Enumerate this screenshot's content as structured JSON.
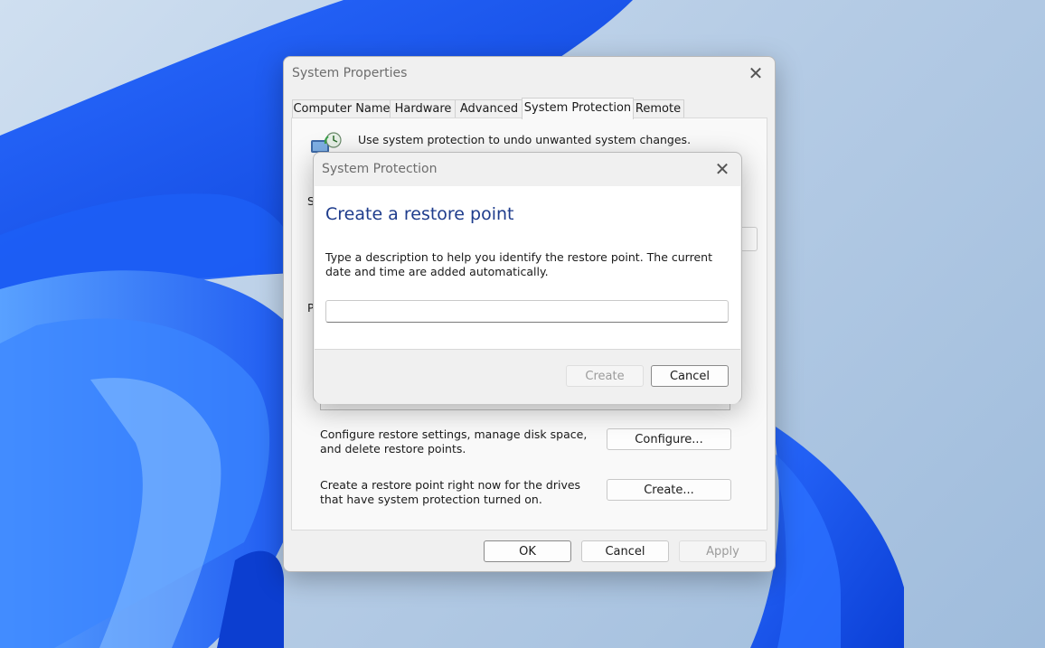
{
  "system_properties": {
    "title": "System Properties",
    "tabs": [
      {
        "label": "Computer Name"
      },
      {
        "label": "Hardware"
      },
      {
        "label": "Advanced"
      },
      {
        "label": "System Protection",
        "active": true
      },
      {
        "label": "Remote"
      }
    ],
    "intro_text": "Use system protection to undo unwanted system changes.",
    "partial_letter_1": "S",
    "partial_letter_2": "P",
    "configure_text": "Configure restore settings, manage disk space, and delete restore points.",
    "configure_label": "Configure...",
    "create_text": "Create a restore point right now for the drives that have system protection turned on.",
    "create_label": "Create...",
    "ok_label": "OK",
    "cancel_label": "Cancel",
    "apply_label": "Apply"
  },
  "system_protection_dialog": {
    "title": "System Protection",
    "heading": "Create a restore point",
    "description": "Type a description to help you identify the restore point. The current date and time are added automatically.",
    "input_value": "",
    "input_placeholder": "",
    "create_label": "Create",
    "cancel_label": "Cancel"
  },
  "icons": {
    "close": "close-icon",
    "system_protection": "system-protection-icon"
  }
}
